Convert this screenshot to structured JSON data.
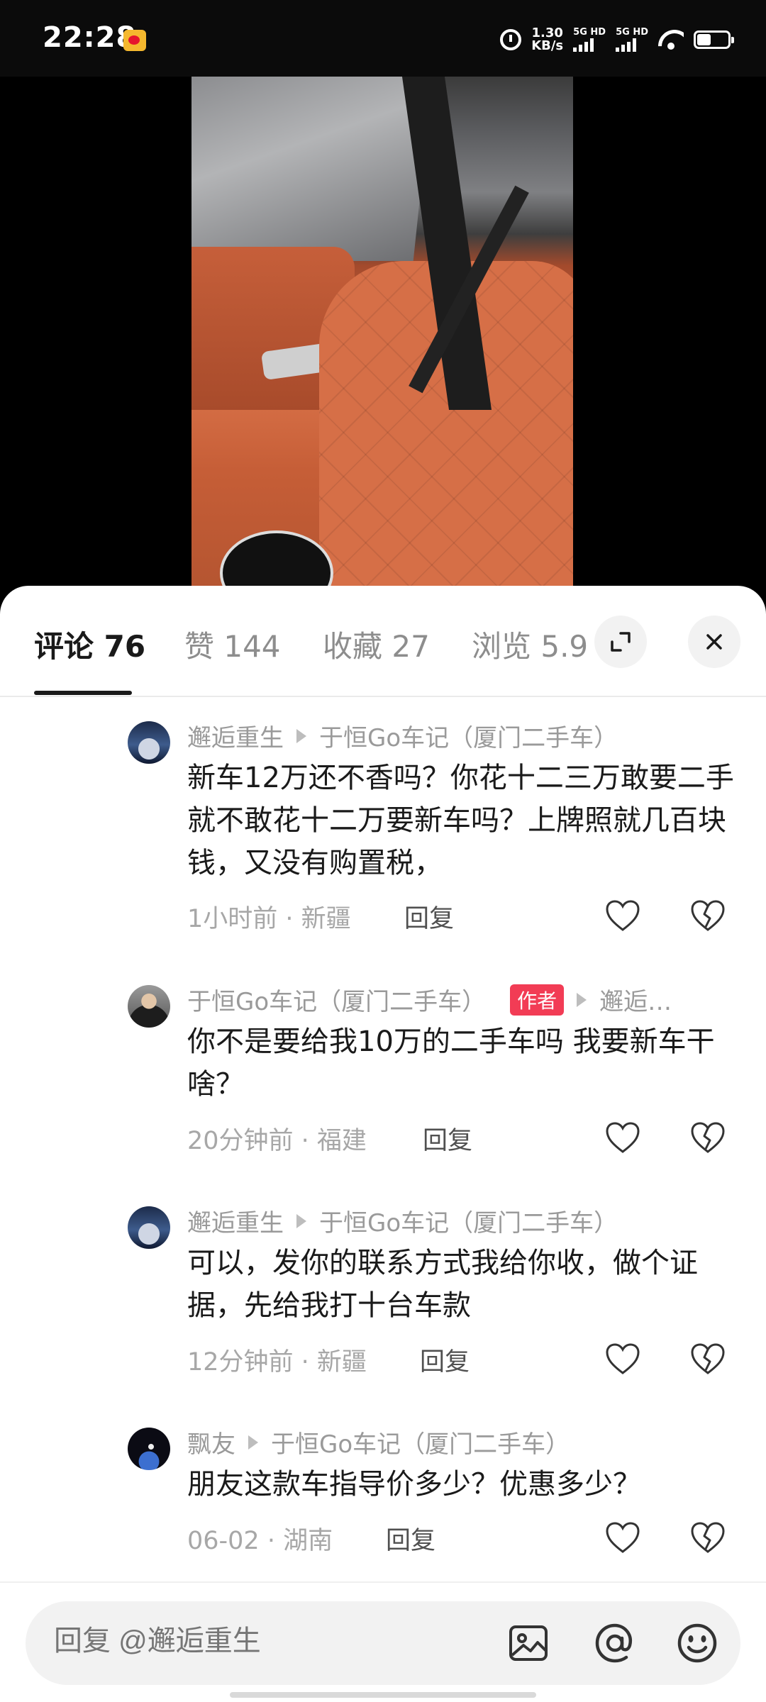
{
  "status_bar": {
    "time": "22:28",
    "speed_value": "1.30",
    "speed_unit": "KB/s",
    "sim1_label": "5G HD",
    "sim2_label": "5G HD"
  },
  "tabs": [
    {
      "label": "评论 76",
      "active": true
    },
    {
      "label": "赞 144",
      "active": false
    },
    {
      "label": "收藏 27",
      "active": false
    },
    {
      "label": "浏览 5.9",
      "active": false
    }
  ],
  "comments": [
    {
      "author": "邂逅重生",
      "reply_to": "于恒Go车记（厦门二手车）",
      "text": "新车12万还不香吗？你花十二三万敢要二手就不敢花十二万要新车吗？上牌照就几百块钱，又没有购置税，",
      "time_location": "1小时前 · 新疆",
      "reply_label": "回复"
    },
    {
      "author": "于恒Go车记（厦门二手车）",
      "badge": "作者",
      "reply_to": "邂逅…",
      "text": "你不是要给我10万的二手车吗 我要新车干啥？",
      "time_location": "20分钟前 · 福建",
      "reply_label": "回复"
    },
    {
      "author": "邂逅重生",
      "reply_to": "于恒Go车记（厦门二手车）",
      "text": "可以，发你的联系方式我给你收，做个证据，先给我打十台车款",
      "time_location": "12分钟前 · 新疆",
      "reply_label": "回复"
    },
    {
      "author": "飘友",
      "reply_to": "于恒Go车记（厦门二手车）",
      "text": "朋友这款车指导价多少？优惠多少？",
      "time_location": "06-02 · 湖南",
      "reply_label": "回复"
    }
  ],
  "reply_bar": {
    "placeholder": "回复 @邂逅重生"
  },
  "icons": {
    "expand": "expand-icon",
    "close": "close-icon",
    "like": "heart-icon",
    "dislike": "broken-heart-icon",
    "image": "image-icon",
    "mention": "at-icon",
    "emoji": "emoji-icon"
  },
  "colors": {
    "author_badge": "#f23c55",
    "active_tab": "#1a1a1a",
    "inactive_tab": "#8d8d8d"
  }
}
